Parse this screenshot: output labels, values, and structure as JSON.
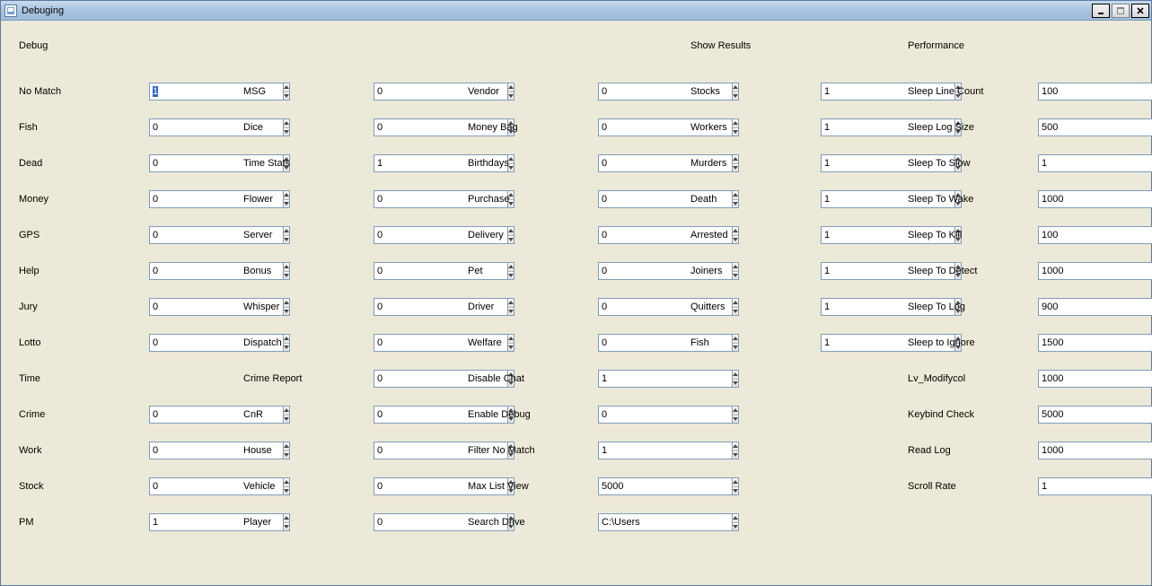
{
  "window": {
    "title": "Debuging"
  },
  "sections": {
    "debug": "Debug",
    "show_results": "Show Results",
    "performance": "Performance"
  },
  "col1": [
    {
      "label": "No Match",
      "value": "1",
      "key": "no-match",
      "selected": true
    },
    {
      "label": "Fish",
      "value": "0",
      "key": "fish"
    },
    {
      "label": "Dead",
      "value": "0",
      "key": "dead"
    },
    {
      "label": "Money",
      "value": "0",
      "key": "money"
    },
    {
      "label": "GPS",
      "value": "0",
      "key": "gps"
    },
    {
      "label": "Help",
      "value": "0",
      "key": "help"
    },
    {
      "label": "Jury",
      "value": "0",
      "key": "jury"
    },
    {
      "label": "Lotto",
      "value": "0",
      "key": "lotto"
    },
    {
      "label": "Time",
      "value": null,
      "key": "time"
    },
    {
      "label": "Crime",
      "value": "0",
      "key": "crime"
    },
    {
      "label": "Work",
      "value": "0",
      "key": "work"
    },
    {
      "label": "Stock",
      "value": "0",
      "key": "stock"
    },
    {
      "label": "PM",
      "value": "1",
      "key": "pm"
    }
  ],
  "col2": [
    {
      "label": "MSG",
      "value": "0",
      "key": "msg"
    },
    {
      "label": "Dice",
      "value": "0",
      "key": "dice"
    },
    {
      "label": "Time Stats",
      "value": "1",
      "key": "time-stats"
    },
    {
      "label": "Flower",
      "value": "0",
      "key": "flower"
    },
    {
      "label": "Server",
      "value": "0",
      "key": "server"
    },
    {
      "label": "Bonus",
      "value": "0",
      "key": "bonus"
    },
    {
      "label": "Whisper",
      "value": "0",
      "key": "whisper"
    },
    {
      "label": "Dispatch",
      "value": "0",
      "key": "dispatch"
    },
    {
      "label": "Crime Report",
      "value": "0",
      "key": "crime-report"
    },
    {
      "label": "CnR",
      "value": "0",
      "key": "cnr"
    },
    {
      "label": "House",
      "value": "0",
      "key": "house"
    },
    {
      "label": "Vehicle",
      "value": "0",
      "key": "vehicle"
    },
    {
      "label": "Player",
      "value": "0",
      "key": "player"
    }
  ],
  "col3": [
    {
      "label": "Vendor",
      "value": "0",
      "key": "vendor"
    },
    {
      "label": "Money Bag",
      "value": "0",
      "key": "money-bag"
    },
    {
      "label": "Birthdays",
      "value": "0",
      "key": "birthdays"
    },
    {
      "label": "Purchase",
      "value": "0",
      "key": "purchase"
    },
    {
      "label": "Delivery",
      "value": "0",
      "key": "delivery"
    },
    {
      "label": "Pet",
      "value": "0",
      "key": "pet"
    },
    {
      "label": "Driver",
      "value": "0",
      "key": "driver"
    },
    {
      "label": "Welfare",
      "value": "0",
      "key": "welfare"
    },
    {
      "label": "Disable Chat",
      "value": "1",
      "key": "disable-chat"
    },
    {
      "label": "Enable Debug",
      "value": "0",
      "key": "enable-debug"
    },
    {
      "label": "Filter No Match",
      "value": "1",
      "key": "filter-no-match"
    },
    {
      "label": "Max List View",
      "value": "5000",
      "key": "max-list-view"
    },
    {
      "label": "Search Drive",
      "value": "C:\\Users",
      "key": "search-drive"
    }
  ],
  "col4": [
    {
      "label": "Stocks",
      "value": "1",
      "key": "stocks"
    },
    {
      "label": "Workers",
      "value": "1",
      "key": "workers"
    },
    {
      "label": "Murders",
      "value": "1",
      "key": "murders"
    },
    {
      "label": "Death",
      "value": "1",
      "key": "death"
    },
    {
      "label": "Arrested",
      "value": "1",
      "key": "arrested"
    },
    {
      "label": "Joiners",
      "value": "1",
      "key": "joiners"
    },
    {
      "label": "Quitters",
      "value": "1",
      "key": "quitters"
    },
    {
      "label": "Fish",
      "value": "1",
      "key": "fish-result"
    }
  ],
  "col5": [
    {
      "label": "Sleep Line Count",
      "value": "100",
      "key": "sleep-line-count"
    },
    {
      "label": "Sleep Log Size",
      "value": "500",
      "key": "sleep-log-size"
    },
    {
      "label": "Sleep To Slow",
      "value": "1",
      "key": "sleep-to-slow"
    },
    {
      "label": "Sleep To Wake",
      "value": "1000",
      "key": "sleep-to-wake"
    },
    {
      "label": "Sleep To Kill",
      "value": "100",
      "key": "sleep-to-kill"
    },
    {
      "label": "Sleep To Detect",
      "value": "1000",
      "key": "sleep-to-detect"
    },
    {
      "label": "Sleep To Log",
      "value": "900",
      "key": "sleep-to-log"
    },
    {
      "label": "Sleep to Ignore",
      "value": "1500",
      "key": "sleep-to-ignore"
    },
    {
      "label": "Lv_Modifycol",
      "value": "1000",
      "key": "lv-modifycol"
    },
    {
      "label": "Keybind Check",
      "value": "5000",
      "key": "keybind-check"
    },
    {
      "label": "Read Log",
      "value": "1000",
      "key": "read-log"
    },
    {
      "label": "Scroll Rate",
      "value": "1",
      "key": "scroll-rate"
    }
  ]
}
